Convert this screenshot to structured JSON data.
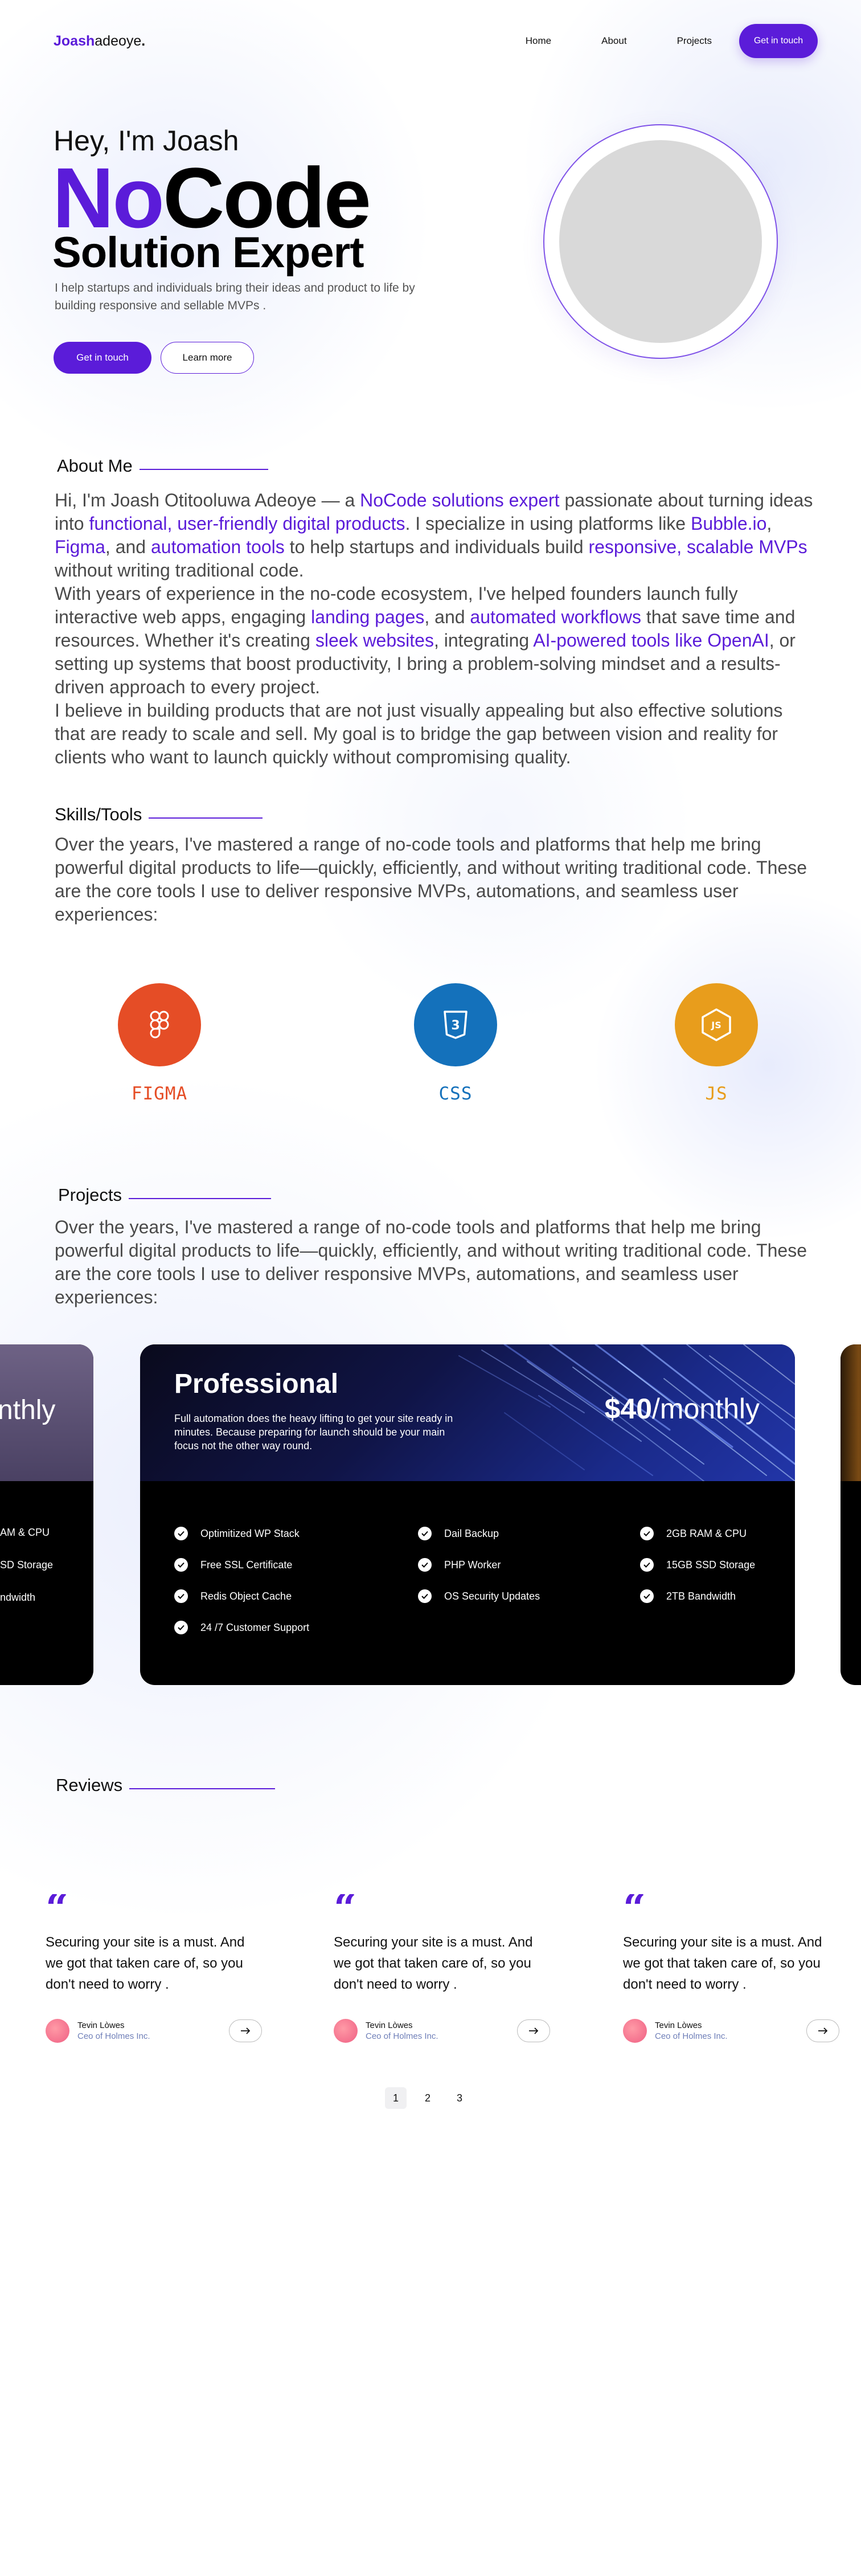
{
  "nav": {
    "logo_accent": "Joash",
    "logo_rest": "adeoye",
    "logo_dot": ".",
    "links": [
      "Home",
      "About",
      "Projects"
    ],
    "cta": "Get in touch"
  },
  "hero": {
    "greeting": "Hey, I'm Joash",
    "title_highlight": "No",
    "title_rest": "Code",
    "subtitle": "Solution Expert",
    "description": "I help startups and individuals bring their ideas and product to life by building responsive  and sellable MVPs .",
    "primary_button": "Get in touch",
    "secondary_button": "Learn more"
  },
  "about": {
    "heading": "About Me",
    "p1_a": "Hi, I'm Joash Otitooluwa Adeoye — a ",
    "p1_b": "NoCode solutions expert",
    "p1_c": " passionate about turning ideas into ",
    "p1_d": "functional, user-friendly digital products",
    "p1_e": ". I specialize in using platforms like ",
    "p1_f": "Bubble.io",
    "p1_g": ", ",
    "p1_h": "Figma",
    "p1_i": ", and ",
    "p1_j": "automation tools",
    "p1_k": " to help startups and individuals build ",
    "p1_l": "responsive, scalable MVPs",
    "p1_m": " without writing traditional code.",
    "p2_a": "With years of experience in the no-code ecosystem, I've helped founders launch fully interactive web apps, engaging ",
    "p2_b": "landing pages",
    "p2_c": ", and ",
    "p2_d": "automated workflows",
    "p2_e": " that save time and resources. Whether it's creating ",
    "p2_f": "sleek websites",
    "p2_g": ", integrating ",
    "p2_h": "AI-powered tools like OpenAI",
    "p2_i": ", or setting up systems that boost productivity, I bring a problem-solving mindset and a results-driven approach to every project.",
    "p3": "I believe in building products that are not just visually appealing but also effective solutions that are ready to scale and sell. My goal is to bridge the gap between vision and reality for clients who want to launch quickly without compromising quality."
  },
  "skills": {
    "heading": "Skills/Tools",
    "description": "Over the years, I've mastered a range of no-code tools and platforms that help me bring powerful digital products to life—quickly, efficiently, and without writing traditional code. These are the core tools I use to deliver responsive MVPs, automations, and seamless user experiences:",
    "items": [
      {
        "label": "FIGMA",
        "icon": "figma-icon",
        "color": "#e54d26"
      },
      {
        "label": "CSS",
        "icon": "css3-icon",
        "color": "#1471bb"
      },
      {
        "label": "JS",
        "icon": "nodejs-icon",
        "color": "#e89d1c"
      }
    ]
  },
  "projects": {
    "heading": "Projects",
    "description": "Over the years, I've mastered a range of no-code tools and platforms that help me bring powerful digital products to life—quickly, efficiently, and without writing traditional code. These are the core tools I use to deliver responsive MVPs, automations, and seamless user experiences:",
    "left_card": {
      "price_partial": "nthly",
      "features": [
        "AM & CPU",
        "SD Storage",
        "ndwidth"
      ]
    },
    "card": {
      "name": "Professional",
      "description": "Full automation does the heavy lifting to get your site ready in minutes. Because preparing for launch should be your main focus not the other way round.",
      "price_amount": "$40",
      "price_period": "/monthly",
      "features": [
        "Optimitized WP Stack",
        "Dail Backup",
        "2GB RAM & CPU",
        "Free SSL Certificate",
        "PHP Worker",
        "15GB SSD Storage",
        "Redis Object Cache",
        "OS Security Updates",
        "2TB Bandwidth",
        "24 /7 Customer Support"
      ]
    }
  },
  "reviews": {
    "heading": "Reviews",
    "items": [
      {
        "text": "Securing your site is a must. And we got that taken care of, so you don't need to worry .",
        "name": "Tevin Lòwes",
        "role": "Ceo of Holmes Inc."
      },
      {
        "text": "Securing your site is a must. And we got that taken care of, so you don't need to worry .",
        "name": "Tevin Lòwes",
        "role": "Ceo of Holmes Inc."
      },
      {
        "text": "Securing your site is a must. And we got that taken care of, so you don't need to worry .",
        "name": "Tevin Lòwes",
        "role": "Ceo of Holmes Inc."
      }
    ],
    "pages": [
      "1",
      "2",
      "3"
    ],
    "active_page": "1"
  },
  "colors": {
    "accent": "#5b1cd9",
    "card_bg": "#000000"
  }
}
